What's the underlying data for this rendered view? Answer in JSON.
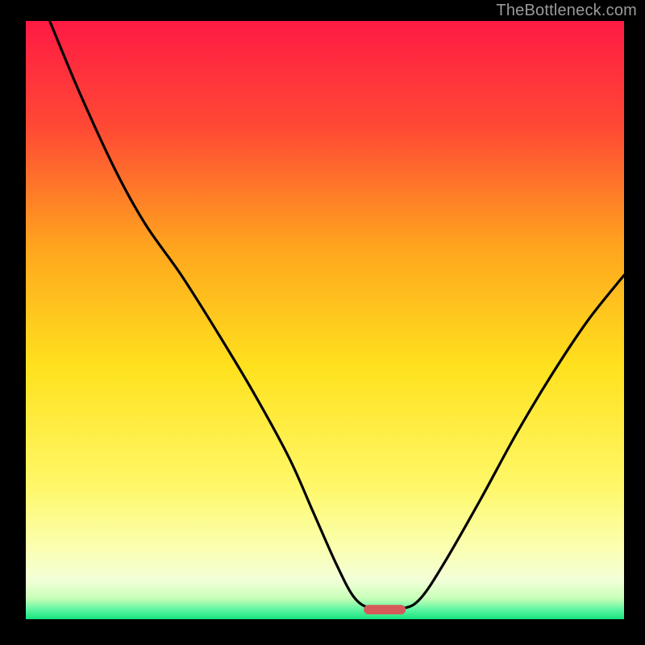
{
  "credit": "TheBottleneck.com",
  "chart_data": {
    "type": "line",
    "title": "",
    "xlabel": "",
    "ylabel": "",
    "xlim": [
      0,
      100
    ],
    "ylim": [
      0,
      100
    ],
    "gradient_stops": [
      {
        "offset": 0.0,
        "color": "#ff1a44"
      },
      {
        "offset": 0.18,
        "color": "#ff4a34"
      },
      {
        "offset": 0.38,
        "color": "#ffa61e"
      },
      {
        "offset": 0.58,
        "color": "#ffe21e"
      },
      {
        "offset": 0.78,
        "color": "#fff86a"
      },
      {
        "offset": 0.88,
        "color": "#fbffb0"
      },
      {
        "offset": 0.935,
        "color": "#f2ffd8"
      },
      {
        "offset": 0.965,
        "color": "#c8ffb8"
      },
      {
        "offset": 0.985,
        "color": "#58f5a0"
      },
      {
        "offset": 1.0,
        "color": "#18e27e"
      }
    ],
    "series": [
      {
        "name": "bottleneck-curve",
        "color": "#000000",
        "points": [
          {
            "x": 4.0,
            "y": 100.0
          },
          {
            "x": 9.0,
            "y": 88.0
          },
          {
            "x": 15.0,
            "y": 75.0
          },
          {
            "x": 20.0,
            "y": 66.0
          },
          {
            "x": 26.0,
            "y": 57.5
          },
          {
            "x": 32.0,
            "y": 48.0
          },
          {
            "x": 38.0,
            "y": 38.0
          },
          {
            "x": 44.0,
            "y": 27.0
          },
          {
            "x": 48.0,
            "y": 18.0
          },
          {
            "x": 52.0,
            "y": 9.0
          },
          {
            "x": 55.0,
            "y": 3.5
          },
          {
            "x": 58.0,
            "y": 1.8
          },
          {
            "x": 63.0,
            "y": 1.8
          },
          {
            "x": 66.0,
            "y": 3.5
          },
          {
            "x": 70.0,
            "y": 9.5
          },
          {
            "x": 76.0,
            "y": 20.0
          },
          {
            "x": 82.0,
            "y": 31.0
          },
          {
            "x": 88.0,
            "y": 41.0
          },
          {
            "x": 94.0,
            "y": 50.0
          },
          {
            "x": 100.0,
            "y": 57.5
          }
        ]
      }
    ],
    "marker": {
      "name": "optimal-marker",
      "x": 60.0,
      "y": 1.6,
      "width": 7.0,
      "height": 1.6,
      "color": "#d65a5a"
    }
  }
}
